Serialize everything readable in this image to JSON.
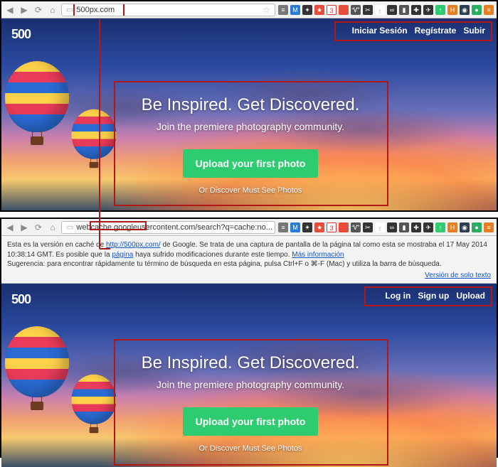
{
  "top": {
    "url": "500px.com",
    "nav": {
      "login": "Iniciar Sesión",
      "signup": "Regístrate",
      "upload": "Subir"
    },
    "logo": "500",
    "hero": {
      "headline": "Be Inspired. Get Discovered.",
      "sub": "Join the premiere photography community.",
      "cta": "Upload your first photo",
      "discover": "Or Discover Must See Photos"
    }
  },
  "bottom": {
    "url": "webcache.googleusercontent.com/search?q=cache:no...",
    "cache": {
      "line1_a": "Esta es la versión en caché de ",
      "link": "http://500px.com/",
      "line1_b": " de Google. Se trata de una captura de pantalla de la página tal como esta se mostraba el 17 May 2014 10:38:14 GMT. Es posible que la ",
      "pagina": "página",
      "line1_c": " haya sufrido modificaciones durante este tiempo. ",
      "more": "Más información",
      "line2": "Sugerencia: para encontrar rápidamente tu término de búsqueda en esta página, pulsa Ctrl+F o ⌘-F (Mac) y utiliza la barra de búsqueda.",
      "textver": "Versión de solo texto"
    },
    "nav": {
      "login": "Log in",
      "signup": "Sign up",
      "upload": "Upload"
    },
    "logo": "500",
    "hero": {
      "headline": "Be Inspired. Get Discovered.",
      "sub": "Join the premiere photography community.",
      "cta": "Upload your first photo",
      "discover": "Or Discover Must See Photos"
    }
  },
  "ext_icons": [
    {
      "bg": "#777",
      "t": "≡"
    },
    {
      "bg": "#2a7bd4",
      "t": "M"
    },
    {
      "bg": "#333",
      "t": "✦"
    },
    {
      "bg": "#e74c3c",
      "t": "★"
    },
    {
      "bg": "#fff",
      "t": "3",
      "fg": "#d33",
      "bd": "#d33"
    },
    {
      "bg": "#e74c3c",
      "t": ""
    },
    {
      "bg": "#555",
      "t": "Ꮙ"
    },
    {
      "bg": "#333",
      "t": "✂"
    },
    {
      "bg": "#fff",
      "t": "⍛",
      "fg": "#888"
    },
    {
      "bg": "#333",
      "t": "∞"
    },
    {
      "bg": "#555",
      "t": "▮"
    },
    {
      "bg": "#333",
      "t": "✚"
    },
    {
      "bg": "#333",
      "t": "✈"
    },
    {
      "bg": "#2ecc71",
      "t": "↑"
    },
    {
      "bg": "#e67e22",
      "t": "H"
    },
    {
      "bg": "#2c3e50",
      "t": "◉"
    },
    {
      "bg": "#27ae60",
      "t": "●"
    },
    {
      "bg": "#e67e22",
      "t": "≡"
    }
  ]
}
